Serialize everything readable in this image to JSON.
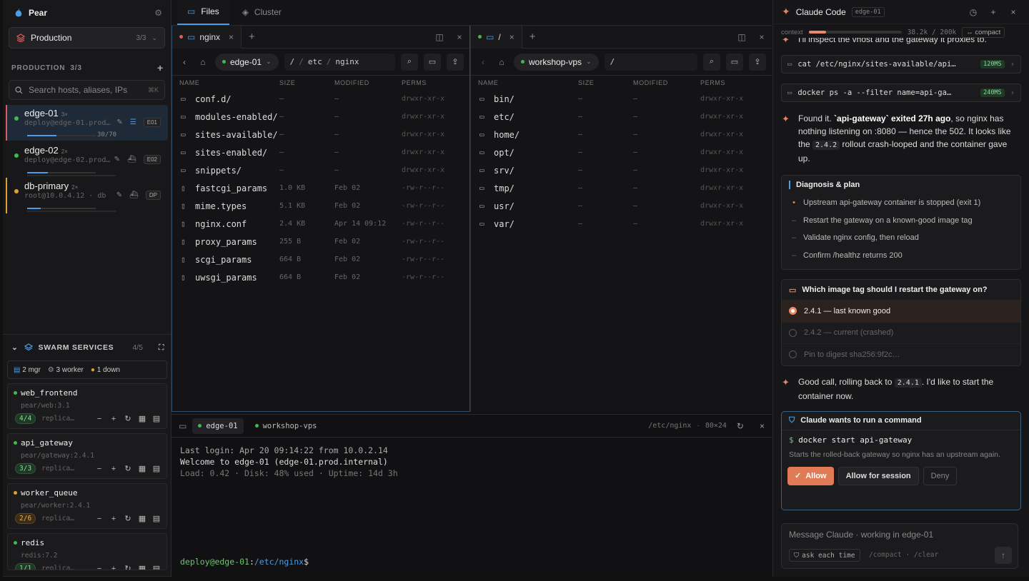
{
  "app": {
    "name": "Pear"
  },
  "env": {
    "label": "Production",
    "count": "3/3"
  },
  "hosts_section": {
    "title": "PRODUCTION",
    "count": "3/3"
  },
  "search": {
    "placeholder": "Search hosts, aliases, IPs",
    "shortcut": "⌘K"
  },
  "hosts": [
    {
      "name": "edge-01",
      "conns": "3×",
      "sub": "deploy@edge-01.prod…",
      "tag": "E01",
      "progress": "30/70",
      "bar": 0.43
    },
    {
      "name": "edge-02",
      "conns": "2×",
      "sub": "deploy@edge-02.prod…",
      "tag": "E02",
      "bar": 0.3
    },
    {
      "name": "db-primary",
      "conns": "2×",
      "sub": "root@10.0.4.12 · db",
      "tag": "DP",
      "bar": 0.2
    }
  ],
  "swarm": {
    "title": "SWARM SERVICES",
    "count": "4/5",
    "summary": {
      "mgr": "2 mgr",
      "worker": "3 worker",
      "down": "1 down"
    },
    "services": [
      {
        "name": "web_frontend",
        "image": "pear/web:3.1",
        "replicas": "4/4",
        "rep_label": "replica…"
      },
      {
        "name": "api_gateway",
        "image": "pear/gateway:2.4.1",
        "replicas": "3/3",
        "rep_label": "replica…"
      },
      {
        "name": "worker_queue",
        "image": "pear/worker:2.4.1",
        "replicas": "2/6",
        "rep_label": "replica…"
      },
      {
        "name": "redis",
        "image": "redis:7.2",
        "replicas": "1/1",
        "rep_label": "replica…"
      }
    ]
  },
  "top_tabs": {
    "files": "Files",
    "cluster": "Cluster"
  },
  "left_pane": {
    "tab": "nginx",
    "host": "edge-01",
    "path": [
      "/",
      "etc",
      "nginx"
    ],
    "headers": {
      "name": "NAME",
      "size": "SIZE",
      "modified": "MODIFIED",
      "perms": "PERMS"
    },
    "rows": [
      {
        "n": "conf.d/",
        "s": "—",
        "m": "—",
        "p": "drwxr-xr-x",
        "dir": true
      },
      {
        "n": "modules-enabled/",
        "s": "—",
        "m": "—",
        "p": "drwxr-xr-x",
        "dir": true
      },
      {
        "n": "sites-available/",
        "s": "—",
        "m": "—",
        "p": "drwxr-xr-x",
        "dir": true
      },
      {
        "n": "sites-enabled/",
        "s": "—",
        "m": "—",
        "p": "drwxr-xr-x",
        "dir": true
      },
      {
        "n": "snippets/",
        "s": "—",
        "m": "—",
        "p": "drwxr-xr-x",
        "dir": true
      },
      {
        "n": "fastcgi_params",
        "s": "1.0 KB",
        "m": "Feb 02",
        "p": "-rw-r--r--",
        "dir": false
      },
      {
        "n": "mime.types",
        "s": "5.1 KB",
        "m": "Feb 02",
        "p": "-rw-r--r--",
        "dir": false
      },
      {
        "n": "nginx.conf",
        "s": "2.4 KB",
        "m": "Apr 14 09:12",
        "p": "-rw-r--r--",
        "dir": false
      },
      {
        "n": "proxy_params",
        "s": "255 B",
        "m": "Feb 02",
        "p": "-rw-r--r--",
        "dir": false
      },
      {
        "n": "scgi_params",
        "s": "664 B",
        "m": "Feb 02",
        "p": "-rw-r--r--",
        "dir": false
      },
      {
        "n": "uwsgi_params",
        "s": "664 B",
        "m": "Feb 02",
        "p": "-rw-r--r--",
        "dir": false
      }
    ]
  },
  "right_pane": {
    "tab": "/",
    "host": "workshop-vps",
    "path": "/",
    "rows": [
      {
        "n": "bin/",
        "s": "—",
        "m": "—",
        "p": "drwxr-xr-x"
      },
      {
        "n": "etc/",
        "s": "—",
        "m": "—",
        "p": "drwxr-xr-x"
      },
      {
        "n": "home/",
        "s": "—",
        "m": "—",
        "p": "drwxr-xr-x"
      },
      {
        "n": "opt/",
        "s": "—",
        "m": "—",
        "p": "drwxr-xr-x"
      },
      {
        "n": "srv/",
        "s": "—",
        "m": "—",
        "p": "drwxr-xr-x"
      },
      {
        "n": "tmp/",
        "s": "—",
        "m": "—",
        "p": "drwxr-xr-x"
      },
      {
        "n": "usr/",
        "s": "—",
        "m": "—",
        "p": "drwxr-xr-x"
      },
      {
        "n": "var/",
        "s": "—",
        "m": "—",
        "p": "drwxr-xr-x"
      }
    ]
  },
  "terminal": {
    "tab1": "edge-01",
    "tab2": "workshop-vps",
    "cwd": "/etc/nginx",
    "size": "80×24",
    "lines": [
      "Last login: Apr 20 09:14:22 from 10.0.2.14",
      "Welcome to edge-01 (edge-01.prod.internal)",
      "Load: 0.42 · Disk: 48% used · Uptime: 14d 3h"
    ],
    "prompt_user": "deploy@edge-01",
    "prompt_sep": ":",
    "prompt_path": "/etc/nginx",
    "prompt_end": "$"
  },
  "claude": {
    "title": "Claude Code",
    "host_tag": "edge-01",
    "context": {
      "label": "context",
      "used": "38.2k / 200k",
      "fraction": 0.19,
      "compact": "compact"
    },
    "intro": "I'll inspect the vhost and the gateway it proxies to.",
    "cmds": [
      {
        "text": "cat /etc/nginx/sites-available/api…",
        "ms": "120MS"
      },
      {
        "text": "docker ps -a --filter name=api-ga…",
        "ms": "240MS"
      }
    ],
    "found": {
      "a": "Found it. ",
      "b": "`api-gateway` exited 27h ago",
      "c": ", so nginx has nothing listening on :8080 — hence the 502. It looks like the ",
      "code": "2.4.2",
      "d": " rollout crash-looped and the container gave up."
    },
    "plan": {
      "title": "Diagnosis & plan",
      "items": [
        "Upstream api-gateway container is stopped (exit 1)",
        "Restart the gateway on a known-good image tag",
        "Validate nginx config, then reload",
        "Confirm /healthz returns 200"
      ]
    },
    "question": {
      "title": "Which image tag should I restart the gateway on?",
      "options": [
        "2.4.1 — last known good",
        "2.4.2 — current (crashed)",
        "Pin to digest sha256:9f2c…"
      ]
    },
    "reply": {
      "a": "Good call, rolling back to ",
      "code": "2.4.1",
      "b": ". I'd like to start the container now."
    },
    "perm": {
      "title": "Claude wants to run a command",
      "prompt": "$",
      "cmd": "docker start api-gateway",
      "desc": "Starts the rolled-back gateway so nginx has an upstream again.",
      "allow": "Allow",
      "session": "Allow for session",
      "deny": "Deny"
    },
    "input": {
      "placeholder": "Message Claude · working in edge-01",
      "ask": "ask each time",
      "hints": "/compact · /clear"
    }
  }
}
